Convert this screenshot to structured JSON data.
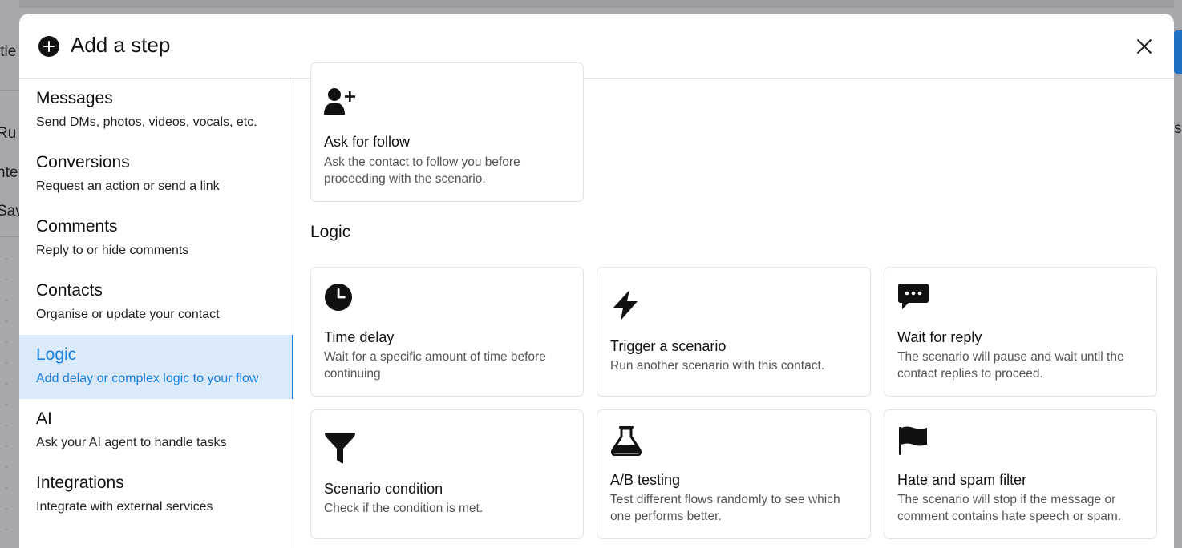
{
  "background": {
    "fragments": [
      "itle",
      "Ru",
      "nte",
      "Sav",
      "s"
    ],
    "accent_color": "#1f6fc5"
  },
  "modal": {
    "title": "Add a step",
    "header_icon": "plus-circle-icon",
    "close_icon": "close-icon"
  },
  "sidebar": {
    "items": [
      {
        "title": "Messages",
        "desc": "Send DMs, photos, videos, vocals, etc."
      },
      {
        "title": "Conversions",
        "desc": "Request an action or send a link"
      },
      {
        "title": "Comments",
        "desc": "Reply to or hide comments"
      },
      {
        "title": "Contacts",
        "desc": "Organise or update your contact"
      },
      {
        "title": "Logic",
        "desc": "Add delay or complex logic to your flow",
        "active": true
      },
      {
        "title": "AI",
        "desc": "Ask your AI agent to handle tasks"
      },
      {
        "title": "Integrations",
        "desc": "Integrate with external services"
      }
    ],
    "active_color": "#1d7fe0"
  },
  "contacts_partial": {
    "card": {
      "title": "Ask for follow",
      "desc": "Ask the contact to follow you before proceeding with the scenario.",
      "icon": "user-plus-icon"
    }
  },
  "logic": {
    "section_title": "Logic",
    "cards": [
      {
        "title": "Time delay",
        "desc": "Wait for a specific amount of time before continuing",
        "icon": "clock-icon"
      },
      {
        "title": "Trigger a scenario",
        "desc": "Run another scenario with this contact.",
        "icon": "bolt-icon"
      },
      {
        "title": "Wait for reply",
        "desc": "The scenario will pause and wait until the contact replies to proceed.",
        "icon": "chat-bubble-icon"
      },
      {
        "title": "Scenario condition",
        "desc": "Check if the condition is met.",
        "icon": "filter-icon"
      },
      {
        "title": "A/B testing",
        "desc": "Test different flows randomly to see which one performs better.",
        "icon": "flask-icon"
      },
      {
        "title": "Hate and spam filter",
        "desc": "The scenario will stop if the message or comment contains hate speech or spam.",
        "icon": "flag-icon"
      }
    ]
  }
}
